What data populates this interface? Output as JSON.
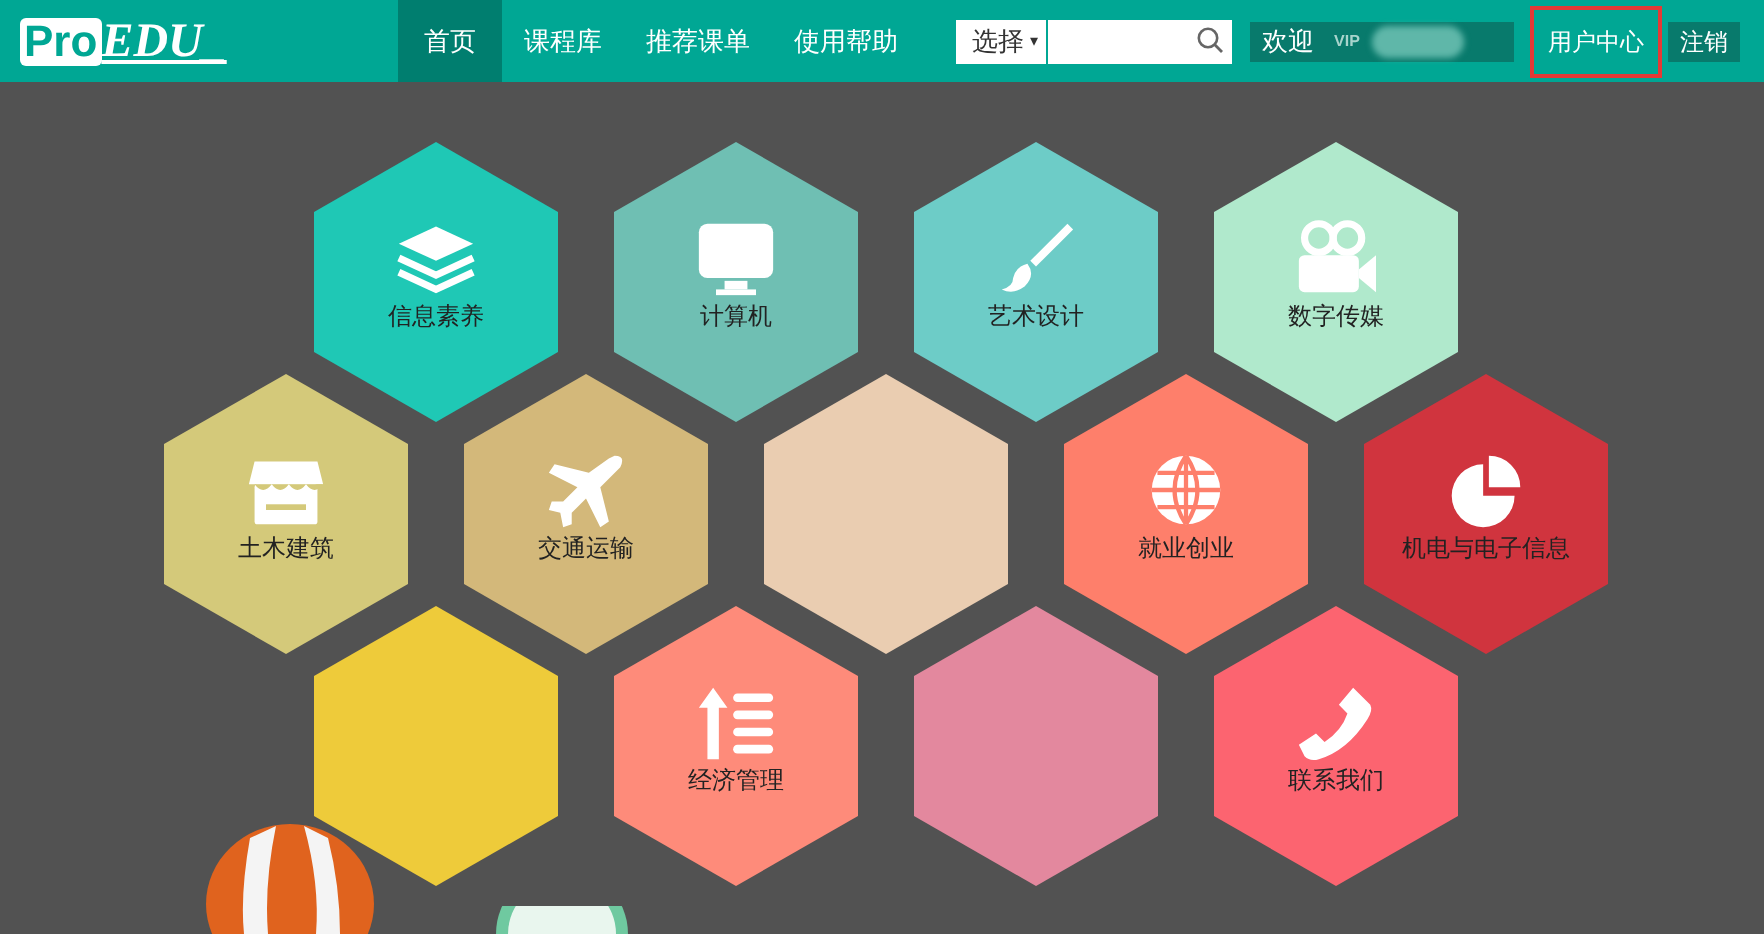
{
  "logo": {
    "boxed": "Pro",
    "rest": "EDU_"
  },
  "nav": [
    {
      "label": "首页",
      "selected": true
    },
    {
      "label": "课程库",
      "selected": false
    },
    {
      "label": "推荐课单",
      "selected": false
    },
    {
      "label": "使用帮助",
      "selected": false
    }
  ],
  "search": {
    "select": "选择",
    "caret": "▾"
  },
  "user": {
    "welcome": "欢迎",
    "badge": "VIP",
    "links": [
      {
        "label": "用户中心",
        "highlighted": true
      },
      {
        "label": "注销",
        "highlighted": false
      }
    ]
  },
  "tiles": [
    [
      {
        "label": "信息素养",
        "color": "#1fc8b5"
      },
      {
        "label": "计算机",
        "color": "#6fbfb3"
      },
      {
        "label": "艺术设计",
        "color": "#6dccc7"
      },
      {
        "label": "数字传媒",
        "color": "#b0e9cc"
      }
    ],
    [
      {
        "label": "土木建筑",
        "color": "#d4c97a"
      },
      {
        "label": "交通运输",
        "color": "#d3b87a"
      },
      {
        "color": "#eacdb1"
      },
      {
        "label": "就业创业",
        "color": "#fe7f6b"
      },
      {
        "label": "机电与电子信息",
        "color": "#d0343e"
      }
    ],
    [
      {
        "color": "#eecb3a"
      },
      {
        "label": "经济管理",
        "color": "#fe8b7a"
      },
      {
        "color": "#e3889e"
      },
      {
        "label": "联系我们",
        "color": "#fc6470"
      }
    ]
  ]
}
